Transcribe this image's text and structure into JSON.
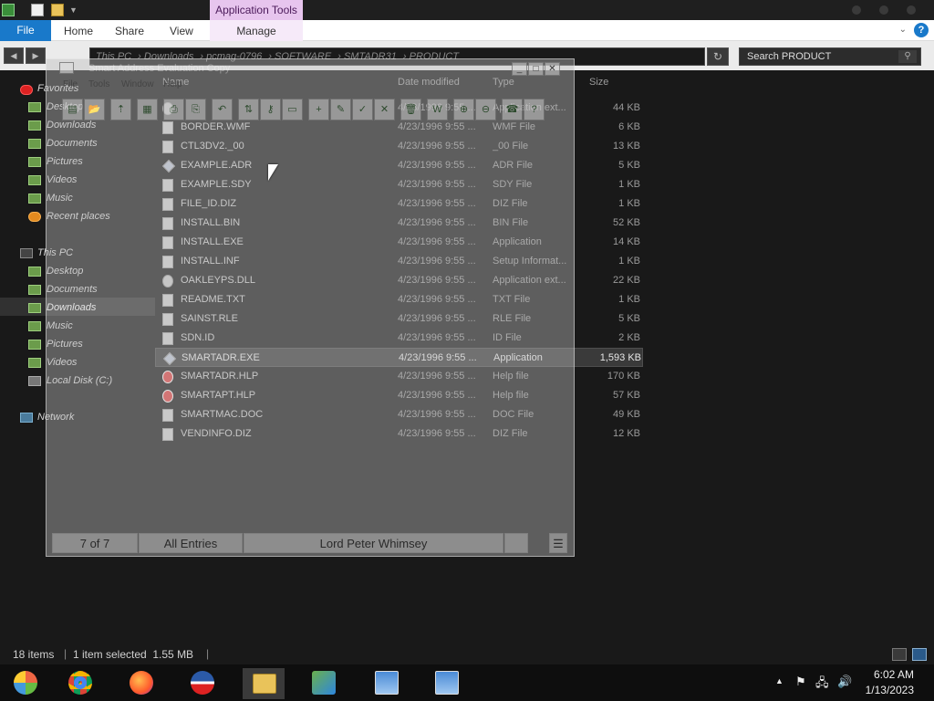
{
  "ribbon": {
    "contextual_header": "Application Tools",
    "file_tab": "File",
    "tabs": [
      "Home",
      "Share",
      "View"
    ],
    "manage_tab": "Manage",
    "help_glyph": "?"
  },
  "address": {
    "crumbs": [
      "This PC",
      "Downloads",
      "pcmag-0796",
      "SOFTWARE",
      "SMTADR31",
      "PRODUCT"
    ],
    "search_placeholder": "Search PRODUCT"
  },
  "nav": {
    "favorites": "Favorites",
    "fav_items": [
      "Desktop",
      "Downloads",
      "Documents",
      "Pictures",
      "Videos",
      "Music",
      "Recent places"
    ],
    "this_pc": "This PC",
    "pc_items": [
      "Desktop",
      "Documents",
      "Downloads",
      "Music",
      "Pictures",
      "Videos",
      "Local Disk (C:)"
    ],
    "network": "Network"
  },
  "columns": {
    "name": "Name",
    "date": "Date modified",
    "type": "Type",
    "size": "Size"
  },
  "files": [
    {
      "name": "",
      "date": "4/23/1996 9:55 ...",
      "type": "Application ext...",
      "size": "44 KB",
      "icon": "gear-icon"
    },
    {
      "name": "BORDER.WMF",
      "date": "4/23/1996 9:55 ...",
      "type": "WMF File",
      "size": "6 KB",
      "icon": "image-file-icon"
    },
    {
      "name": "CTL3DV2._00",
      "date": "4/23/1996 9:55 ...",
      "type": "_00 File",
      "size": "13 KB",
      "icon": "file-icon"
    },
    {
      "name": "EXAMPLE.ADR",
      "date": "4/23/1996 9:55 ...",
      "type": "ADR File",
      "size": "5 KB",
      "icon": "diamond-icon"
    },
    {
      "name": "EXAMPLE.SDY",
      "date": "4/23/1996 9:55 ...",
      "type": "SDY File",
      "size": "1 KB",
      "icon": "file-icon"
    },
    {
      "name": "FILE_ID.DIZ",
      "date": "4/23/1996 9:55 ...",
      "type": "DIZ File",
      "size": "1 KB",
      "icon": "file-icon"
    },
    {
      "name": "INSTALL.BIN",
      "date": "4/23/1996 9:55 ...",
      "type": "BIN File",
      "size": "52 KB",
      "icon": "file-icon"
    },
    {
      "name": "INSTALL.EXE",
      "date": "4/23/1996 9:55 ...",
      "type": "Application",
      "size": "14 KB",
      "icon": "installer-icon"
    },
    {
      "name": "INSTALL.INF",
      "date": "4/23/1996 9:55 ...",
      "type": "Setup Informat...",
      "size": "1 KB",
      "icon": "settings-file-icon"
    },
    {
      "name": "OAKLEYPS.DLL",
      "date": "4/23/1996 9:55 ...",
      "type": "Application ext...",
      "size": "22 KB",
      "icon": "gear-icon"
    },
    {
      "name": "README.TXT",
      "date": "4/23/1996 9:55 ...",
      "type": "TXT File",
      "size": "1 KB",
      "icon": "text-file-icon"
    },
    {
      "name": "SAINST.RLE",
      "date": "4/23/1996 9:55 ...",
      "type": "RLE File",
      "size": "5 KB",
      "icon": "image-file-icon"
    },
    {
      "name": "SDN.ID",
      "date": "4/23/1996 9:55 ...",
      "type": "ID File",
      "size": "2 KB",
      "icon": "file-icon"
    },
    {
      "name": "SMARTADR.EXE",
      "date": "4/23/1996 9:55 ...",
      "type": "Application",
      "size": "1,593 KB",
      "icon": "diamond-icon"
    },
    {
      "name": "SMARTADR.HLP",
      "date": "4/23/1996 9:55 ...",
      "type": "Help file",
      "size": "170 KB",
      "icon": "help-file-icon"
    },
    {
      "name": "SMARTAPT.HLP",
      "date": "4/23/1996 9:55 ...",
      "type": "Help file",
      "size": "57 KB",
      "icon": "help-file-icon"
    },
    {
      "name": "SMARTMAC.DOC",
      "date": "4/23/1996 9:55 ...",
      "type": "DOC File",
      "size": "49 KB",
      "icon": "file-icon"
    },
    {
      "name": "VENDINFO.DIZ",
      "date": "4/23/1996 9:55 ...",
      "type": "DIZ File",
      "size": "12 KB",
      "icon": "file-icon"
    }
  ],
  "appwin": {
    "title": "Smart Address Evaluation Copy",
    "menu": [
      "File",
      "Tools",
      "Window",
      "Help"
    ],
    "status": {
      "record": "7 of 7",
      "filter": "All Entries",
      "name": "Lord Peter Whimsey"
    }
  },
  "statusbar": {
    "items": "18 items",
    "selected": "1 item selected  1.55 MB"
  },
  "clock": {
    "time": "6:02 AM",
    "date": "1/13/2023"
  }
}
